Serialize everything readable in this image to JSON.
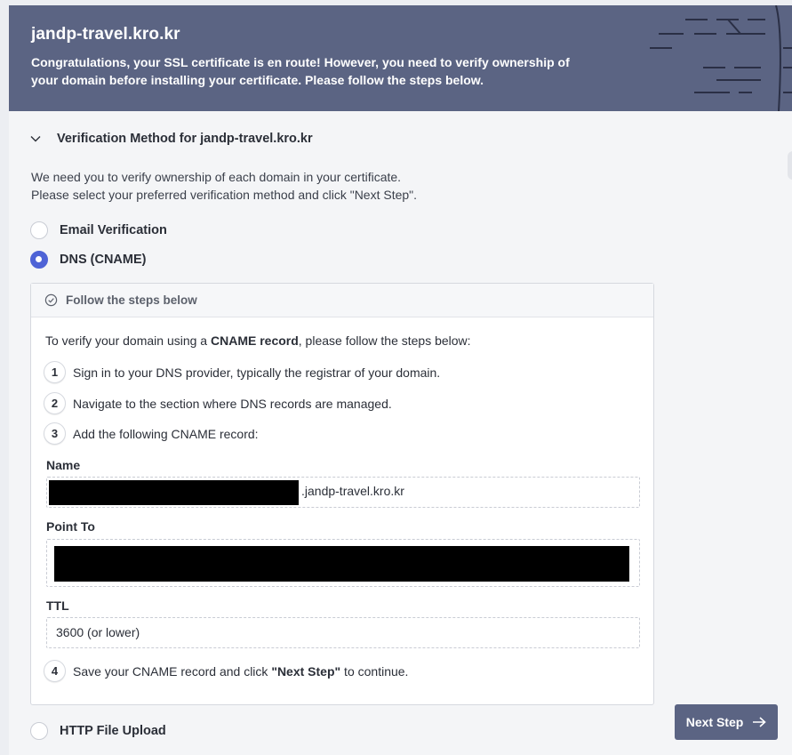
{
  "banner": {
    "domain_title": "jandp-travel.kro.kr",
    "message": "Congratulations, your SSL certificate is en route! However, you need to verify ownership of your domain before installing your certificate. Please follow the steps below."
  },
  "section": {
    "title": "Verification Method for jandp-travel.kro.kr",
    "intro_line1": "We need you to verify ownership of each domain in your certificate.",
    "intro_line2": "Please select your preferred verification method and click \"Next Step\"."
  },
  "methods": [
    {
      "label": "Email Verification",
      "selected": false
    },
    {
      "label": "DNS (CNAME)",
      "selected": true
    },
    {
      "label": "HTTP File Upload",
      "selected": false
    }
  ],
  "panel": {
    "header": "Follow the steps below",
    "intro_prefix": "To verify your domain using a ",
    "intro_bold": "CNAME record",
    "intro_suffix": ", please follow the steps below:",
    "steps": [
      {
        "num": "1",
        "text": "Sign in to your DNS provider, typically the registrar of your domain."
      },
      {
        "num": "2",
        "text": "Navigate to the section where DNS records are managed."
      },
      {
        "num": "3",
        "text": "Add the following CNAME record:"
      },
      {
        "num": "4",
        "text_prefix": "Save your CNAME record and click ",
        "text_bold": "\"Next Step\"",
        "text_suffix": " to continue."
      }
    ],
    "fields": {
      "name_label": "Name",
      "name_suffix": ".jandp-travel.kro.kr",
      "point_to_label": "Point To",
      "ttl_label": "TTL",
      "ttl_value": "3600 (or lower)"
    }
  },
  "next_button": {
    "label": "Next Step",
    "icon": "arrow-right-icon"
  },
  "colors": {
    "banner": "#5b6483",
    "radio_selected": "#4e63d6",
    "button": "#5b6483"
  }
}
